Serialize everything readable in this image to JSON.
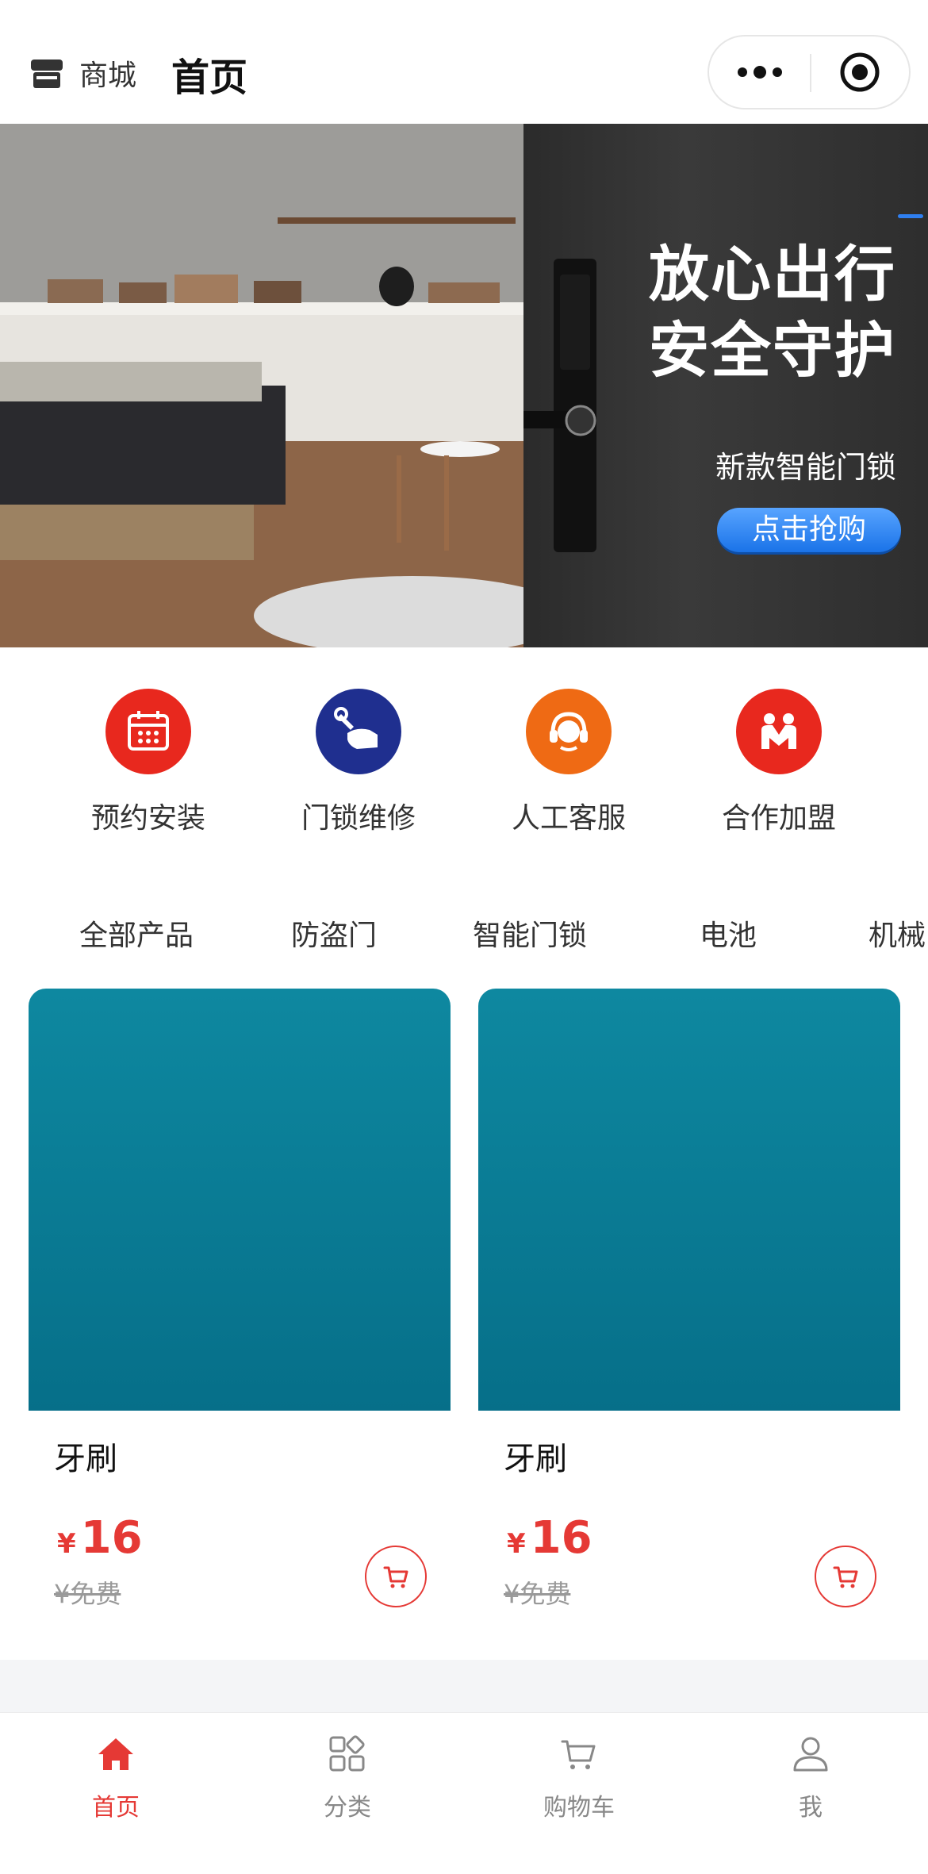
{
  "header": {
    "store_label": "商城",
    "title": "首页",
    "store_icon": "store-icon",
    "more_icon": "more-dots-icon",
    "target_icon": "target-icon"
  },
  "banner": {
    "line1": "放心出行",
    "line2": "安全守护",
    "subtitle": "新款智能门锁",
    "button": "点击抢购"
  },
  "services": [
    {
      "label": "预约安装",
      "icon": "calendar-icon",
      "color": "#e8281e"
    },
    {
      "label": "门锁维修",
      "icon": "wrench-hand-icon",
      "color": "#1f2f8f"
    },
    {
      "label": "人工客服",
      "icon": "headset-agent-icon",
      "color": "#ef6a14"
    },
    {
      "label": "合作加盟",
      "icon": "partnership-icon",
      "color": "#e8281e"
    }
  ],
  "categories": [
    "全部产品",
    "防盗门",
    "智能门锁",
    "电池",
    "机械"
  ],
  "products": [
    {
      "name": "牙刷",
      "currency": "¥",
      "price": "16",
      "original": "¥免费"
    },
    {
      "name": "牙刷",
      "currency": "¥",
      "price": "16",
      "original": "¥免费"
    }
  ],
  "tabbar": {
    "active_color": "#e53935",
    "items": [
      {
        "label": "首页",
        "icon": "home-icon"
      },
      {
        "label": "分类",
        "icon": "category-icon"
      },
      {
        "label": "购物车",
        "icon": "cart-icon"
      },
      {
        "label": "我",
        "icon": "user-icon"
      }
    ]
  }
}
